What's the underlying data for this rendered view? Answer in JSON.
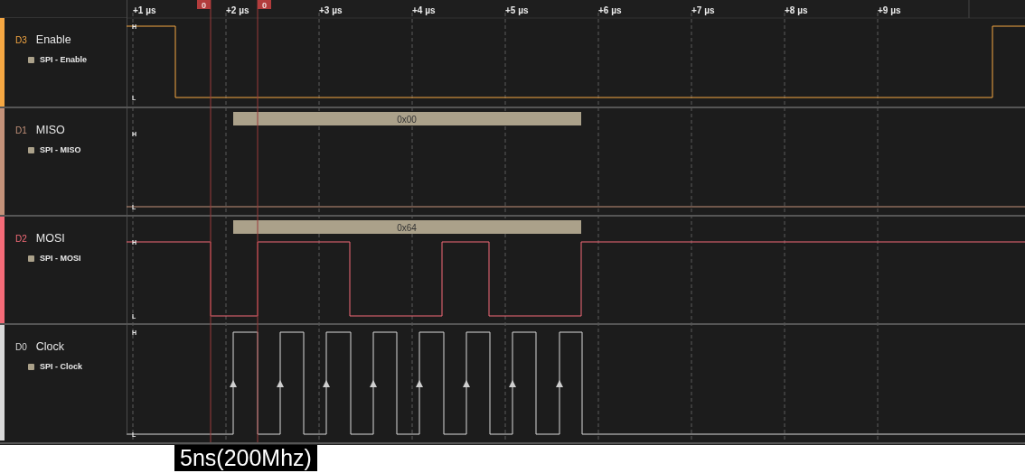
{
  "timeline": {
    "ticks": [
      "+1 µs",
      "+2 µs",
      "+3 µs",
      "+4 µs",
      "+5 µs",
      "+6 µs",
      "+7 µs",
      "+8 µs",
      "+9 µs"
    ],
    "markers": [
      {
        "label": "0"
      },
      {
        "label": "0"
      }
    ]
  },
  "channels": [
    {
      "id": "D3",
      "name": "Enable",
      "analyzer": "SPI - Enable",
      "color": "#f5a742",
      "high_label": "H",
      "low_label": "L"
    },
    {
      "id": "D1",
      "name": "MISO",
      "analyzer": "SPI - MISO",
      "color": "#c4927a",
      "high_label": "H",
      "low_label": "L",
      "frames": [
        {
          "text": "0x00"
        }
      ]
    },
    {
      "id": "D2",
      "name": "MOSI",
      "analyzer": "SPI - MOSI",
      "color": "#f56b78",
      "high_label": "H",
      "low_label": "L",
      "frames": [
        {
          "text": "0x64"
        }
      ]
    },
    {
      "id": "D0",
      "name": "Clock",
      "analyzer": "SPI - Clock",
      "color": "#d9d9d9",
      "high_label": "H",
      "low_label": "L"
    }
  ],
  "caption": "5ns(200Mhz)"
}
